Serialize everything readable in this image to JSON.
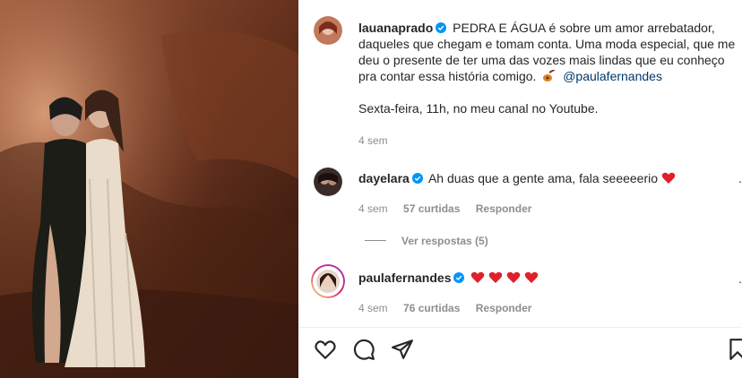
{
  "post": {
    "author": "lauanaprado",
    "caption_lines": [
      "PEDRA E ÁGUA é sobre um amor arrebatador,",
      "daqueles que chegam e tomam conta. Uma moda especial, que me",
      "deu o presente de ter uma das vozes mais lindas que eu conheço",
      "pra contar essa história comigo."
    ],
    "mention": "@paulafernandes",
    "second_paragraph": "Sexta-feira, 11h, no meu canal no Youtube.",
    "time": "4 sem"
  },
  "comments": [
    {
      "author": "dayelara",
      "text": "Ah duas que a gente ama, fala seeeeerio",
      "time": "4 sem",
      "likes": "57 curtidas",
      "reply": "Responder",
      "view_replies": "Ver respostas (5)"
    },
    {
      "author": "paulafernandes",
      "text": "",
      "time": "4 sem",
      "likes": "76 curtidas",
      "reply": "Responder"
    }
  ],
  "colors": {
    "verified": "#0095f6",
    "heart": "#ed4956",
    "link": "#00376b",
    "meta": "#8e8e8e"
  },
  "icons": [
    "heart-icon",
    "comment-icon",
    "share-icon",
    "bookmark-icon"
  ]
}
